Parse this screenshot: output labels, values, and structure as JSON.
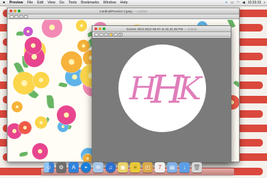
{
  "menubar": {
    "items": [
      "Preview",
      "File",
      "Edit",
      "View",
      "Go",
      "Tools",
      "Bookmarks",
      "Window",
      "Help"
    ],
    "clock": "10:33:19"
  },
  "back_window": {
    "title": "CardinalPeonies 2.jpeg",
    "state": "Locked"
  },
  "front_window": {
    "title": "Screen Shot 2012-08-07 at 10.32.39 PM",
    "state": "Edited",
    "monogram": [
      "H",
      "H",
      "K"
    ]
  },
  "dock": {
    "apps": [
      "finder-icon",
      "system-preferences-icon",
      "app-store-icon",
      "safari-icon",
      "mail-icon",
      "itunes-icon",
      "photos-icon",
      "notes-icon",
      "preview-icon",
      "calendar-icon",
      "folder-icon",
      "downloads-icon",
      "trash-icon"
    ]
  },
  "colors": {
    "stripe_red": "#d83a2c",
    "monogram_pink": "#e07dba",
    "canvas_gray": "#7b7b7b"
  }
}
